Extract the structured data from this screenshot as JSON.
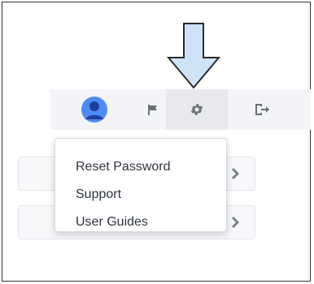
{
  "accent_colors": {
    "arrow_fill": "#cfe3f8",
    "arrow_stroke": "#2a2a2a",
    "avatar_blue": "#4d8cf5",
    "icon_gray": "#6a6f78"
  },
  "toolbar": {
    "icons": [
      "avatar-icon",
      "flag-icon",
      "gear-icon",
      "logout-icon"
    ],
    "active_icon": "gear-icon"
  },
  "settings_menu": {
    "items": [
      {
        "label": "Reset Password"
      },
      {
        "label": "Support"
      },
      {
        "label": "User Guides"
      }
    ]
  }
}
